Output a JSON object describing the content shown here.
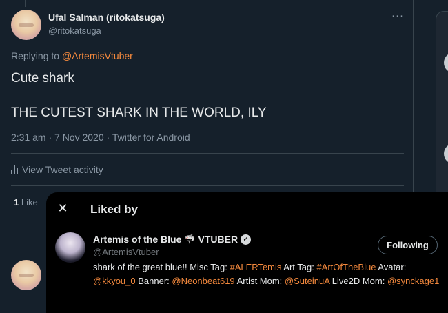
{
  "tweet": {
    "author_name": "Ufal Salman (ritokatsuga)",
    "author_handle": "@ritokatsuga",
    "more_label": "···",
    "replying_prefix": "Replying to ",
    "replying_to": "@ArtemisVtuber",
    "text_line1": "Cute shark",
    "text_line2": "THE CUTEST SHARK IN THE WORLD, ILY",
    "timestamp": "2:31 am · 7 Nov 2020 · Twitter for Android",
    "activity_label": "View Tweet activity",
    "likes_count": "1",
    "likes_label": " Like"
  },
  "liked_by": {
    "title": "Liked by",
    "close_label": "✕",
    "user": {
      "name": "Artemis of the Blue",
      "name_suffix": "VTUBER",
      "shark_emoji": "🦈",
      "verified_mark": "✓",
      "handle": "@ArtemisVtuber",
      "follow_label": "Following",
      "bio": [
        {
          "text": "shark of the great blue!! Misc Tag: ",
          "hl": false
        },
        {
          "text": "#ALERTemis",
          "hl": true
        },
        {
          "text": " Art Tag: ",
          "hl": false
        },
        {
          "text": "#ArtOfTheBlue",
          "hl": true
        },
        {
          "text": " Avatar: ",
          "hl": false
        },
        {
          "text": "@kkyou_0",
          "hl": true
        },
        {
          "text": " Banner: ",
          "hl": false
        },
        {
          "text": "@Neonbeat619",
          "hl": true
        },
        {
          "text": " Artist Mom: ",
          "hl": false
        },
        {
          "text": "@SuteinuA",
          "hl": true
        },
        {
          "text": " Live2D Mom: ",
          "hl": false
        },
        {
          "text": "@synckage1",
          "hl": true
        }
      ]
    }
  },
  "colors": {
    "background": "#15202b",
    "modal": "#000000",
    "accent": "#f4893d",
    "muted": "#8b98a5",
    "border": "#38444d"
  }
}
